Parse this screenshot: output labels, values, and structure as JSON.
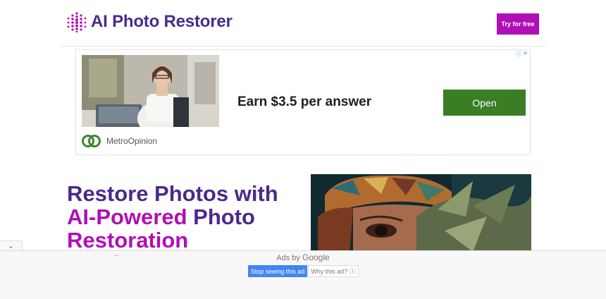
{
  "header": {
    "logo_text": "AI Photo Restorer",
    "cta_label": "Try for free"
  },
  "ad": {
    "headline": "Earn $3.5 per answer",
    "button_label": "Open",
    "advertiser": "MetroOpinion",
    "info_icons": [
      "info-icon",
      "close-icon"
    ]
  },
  "hero": {
    "title_part1": "Restore Photos with ",
    "title_accent1": "AI-Powered",
    "title_part2": " Photo ",
    "title_accent2": "Restoration"
  },
  "anchor_ad": {
    "ads_by_prefix": "Ads by",
    "ads_by_brand": "Google",
    "stop_label": "Stop seeing this ad",
    "why_label": "Why this ad? ⓘ"
  },
  "colors": {
    "brand_purple": "#4a2a8c",
    "brand_magenta": "#b00fb5",
    "ad_green": "#3a7d25",
    "google_blue": "#4285f4"
  }
}
